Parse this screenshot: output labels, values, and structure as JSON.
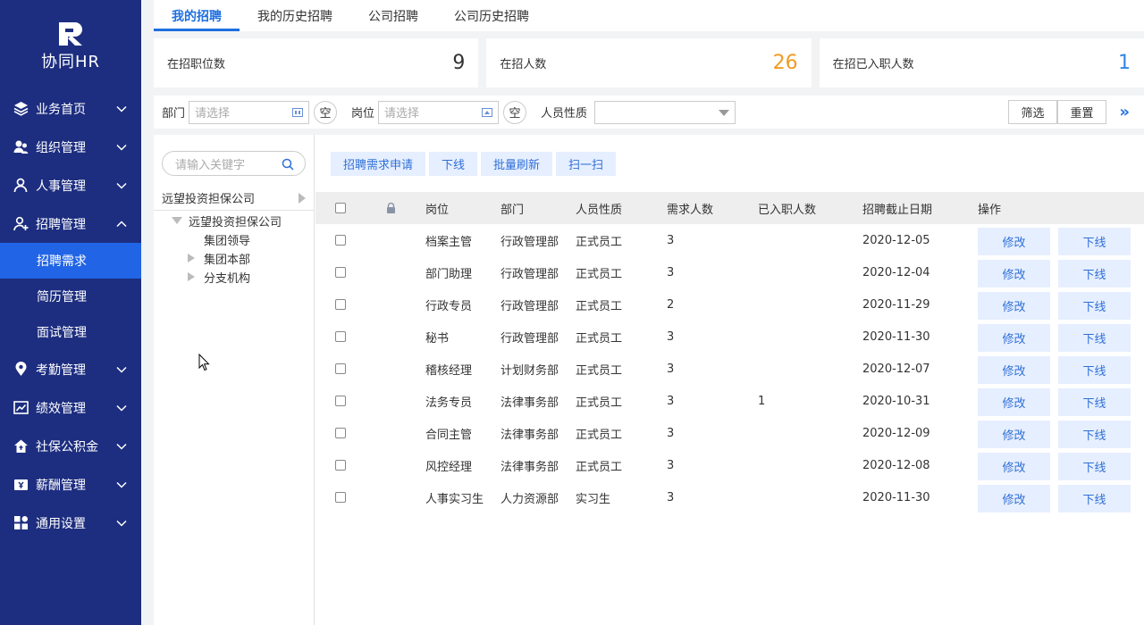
{
  "app": {
    "logo_text": "协同HR"
  },
  "sidebar": {
    "items": [
      {
        "label": "业务首页",
        "icon": "layers-icon"
      },
      {
        "label": "组织管理",
        "icon": "org-icon"
      },
      {
        "label": "人事管理",
        "icon": "person-icon"
      },
      {
        "label": "招聘管理",
        "icon": "add-person-icon",
        "expanded": true,
        "children": [
          {
            "label": "招聘需求",
            "active": true
          },
          {
            "label": "简历管理"
          },
          {
            "label": "面试管理"
          }
        ]
      },
      {
        "label": "考勤管理",
        "icon": "location-icon"
      },
      {
        "label": "绩效管理",
        "icon": "chart-icon"
      },
      {
        "label": "社保公积金",
        "icon": "house-icon"
      },
      {
        "label": "薪酬管理",
        "icon": "salary-icon"
      },
      {
        "label": "通用设置",
        "icon": "grid-icon"
      }
    ]
  },
  "tabs": [
    {
      "label": "我的招聘",
      "active": true
    },
    {
      "label": "我的历史招聘"
    },
    {
      "label": "公司招聘"
    },
    {
      "label": "公司历史招聘"
    }
  ],
  "stats": [
    {
      "label": "在招职位数",
      "value": "9",
      "color": "#333333"
    },
    {
      "label": "在招人数",
      "value": "26",
      "color": "#f29a22"
    },
    {
      "label": "在招已入职人数",
      "value": "1",
      "color": "#2f86e8"
    }
  ],
  "filters": {
    "dept_label": "部门",
    "dept_placeholder": "请选择",
    "post_label": "岗位",
    "post_placeholder": "请选择",
    "empty_label": "空",
    "nature_label": "人员性质",
    "nature_value": "",
    "filter_btn": "筛选",
    "reset_btn": "重置",
    "expand": "»"
  },
  "tree": {
    "search_placeholder": "请输入关键字",
    "root": "远望投资担保公司",
    "nodes": [
      {
        "label": "远望投资担保公司",
        "level": 1,
        "expander": "down"
      },
      {
        "label": "集团领导",
        "level": 2,
        "expander": "none"
      },
      {
        "label": "集团本部",
        "level": 2,
        "expander": "right"
      },
      {
        "label": "分支机构",
        "level": 2,
        "expander": "right"
      }
    ]
  },
  "actions": [
    "招聘需求申请",
    "下线",
    "批量刷新",
    "扫一扫"
  ],
  "table": {
    "headers": {
      "post": "岗位",
      "dept": "部门",
      "nature": "人员性质",
      "demand": "需求人数",
      "hired": "已入职人数",
      "deadline": "招聘截止日期",
      "ops": "操作"
    },
    "edit_label": "修改",
    "offline_label": "下线",
    "rows": [
      {
        "post": "档案主管",
        "dept": "行政管理部",
        "nature": "正式员工",
        "demand": "3",
        "hired": "",
        "deadline": "2020-12-05"
      },
      {
        "post": "部门助理",
        "dept": "行政管理部",
        "nature": "正式员工",
        "demand": "3",
        "hired": "",
        "deadline": "2020-12-04"
      },
      {
        "post": "行政专员",
        "dept": "行政管理部",
        "nature": "正式员工",
        "demand": "2",
        "hired": "",
        "deadline": "2020-11-29"
      },
      {
        "post": "秘书",
        "dept": "行政管理部",
        "nature": "正式员工",
        "demand": "3",
        "hired": "",
        "deadline": "2020-11-30"
      },
      {
        "post": "稽核经理",
        "dept": "计划财务部",
        "nature": "正式员工",
        "demand": "3",
        "hired": "",
        "deadline": "2020-12-07"
      },
      {
        "post": "法务专员",
        "dept": "法律事务部",
        "nature": "正式员工",
        "demand": "3",
        "hired": "1",
        "deadline": "2020-10-31"
      },
      {
        "post": "合同主管",
        "dept": "法律事务部",
        "nature": "正式员工",
        "demand": "3",
        "hired": "",
        "deadline": "2020-12-09"
      },
      {
        "post": "风控经理",
        "dept": "法律事务部",
        "nature": "正式员工",
        "demand": "3",
        "hired": "",
        "deadline": "2020-12-08"
      },
      {
        "post": "人事实习生",
        "dept": "人力资源部",
        "nature": "实习生",
        "demand": "3",
        "hired": "",
        "deadline": "2020-11-30"
      }
    ]
  }
}
